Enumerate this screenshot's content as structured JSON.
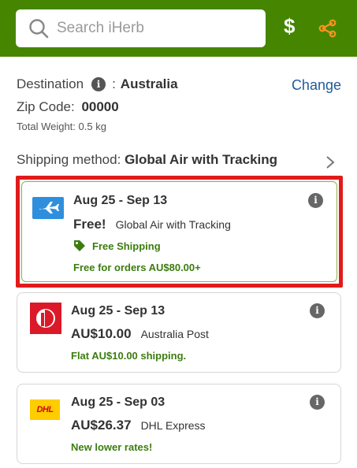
{
  "header": {
    "search_placeholder": "Search iHerb",
    "currency_symbol": "$",
    "brand_color": "#458500"
  },
  "destination": {
    "label": "Destination",
    "separator": ":",
    "country": "Australia",
    "change_label": "Change"
  },
  "zip": {
    "label": "Zip Code:",
    "value": "00000"
  },
  "weight": {
    "text": "Total Weight: 0.5 kg"
  },
  "shipping_method": {
    "label": "Shipping method:",
    "value": "Global Air with Tracking"
  },
  "options": [
    {
      "date_range": "Aug 25 - Sep 13",
      "price": "Free!",
      "carrier": "Global Air with Tracking",
      "badge": "Free Shipping",
      "note": "Free for orders AU$80.00+",
      "icon": "airplane-icon",
      "selected": true
    },
    {
      "date_range": "Aug 25 - Sep 13",
      "price": "AU$10.00",
      "carrier": "Australia Post",
      "note": "Flat AU$10.00 shipping.",
      "icon": "australia-post-logo",
      "selected": false
    },
    {
      "date_range": "Aug 25 - Sep 03",
      "price": "AU$26.37",
      "carrier": "DHL Express",
      "note": "New lower rates!",
      "icon": "dhl-logo",
      "dhl_logo_text": "DHL",
      "selected": false
    }
  ],
  "colors": {
    "selected_border": "#e01b1b",
    "promo_green": "#3c7d0f",
    "link_blue": "#1f5b99"
  }
}
